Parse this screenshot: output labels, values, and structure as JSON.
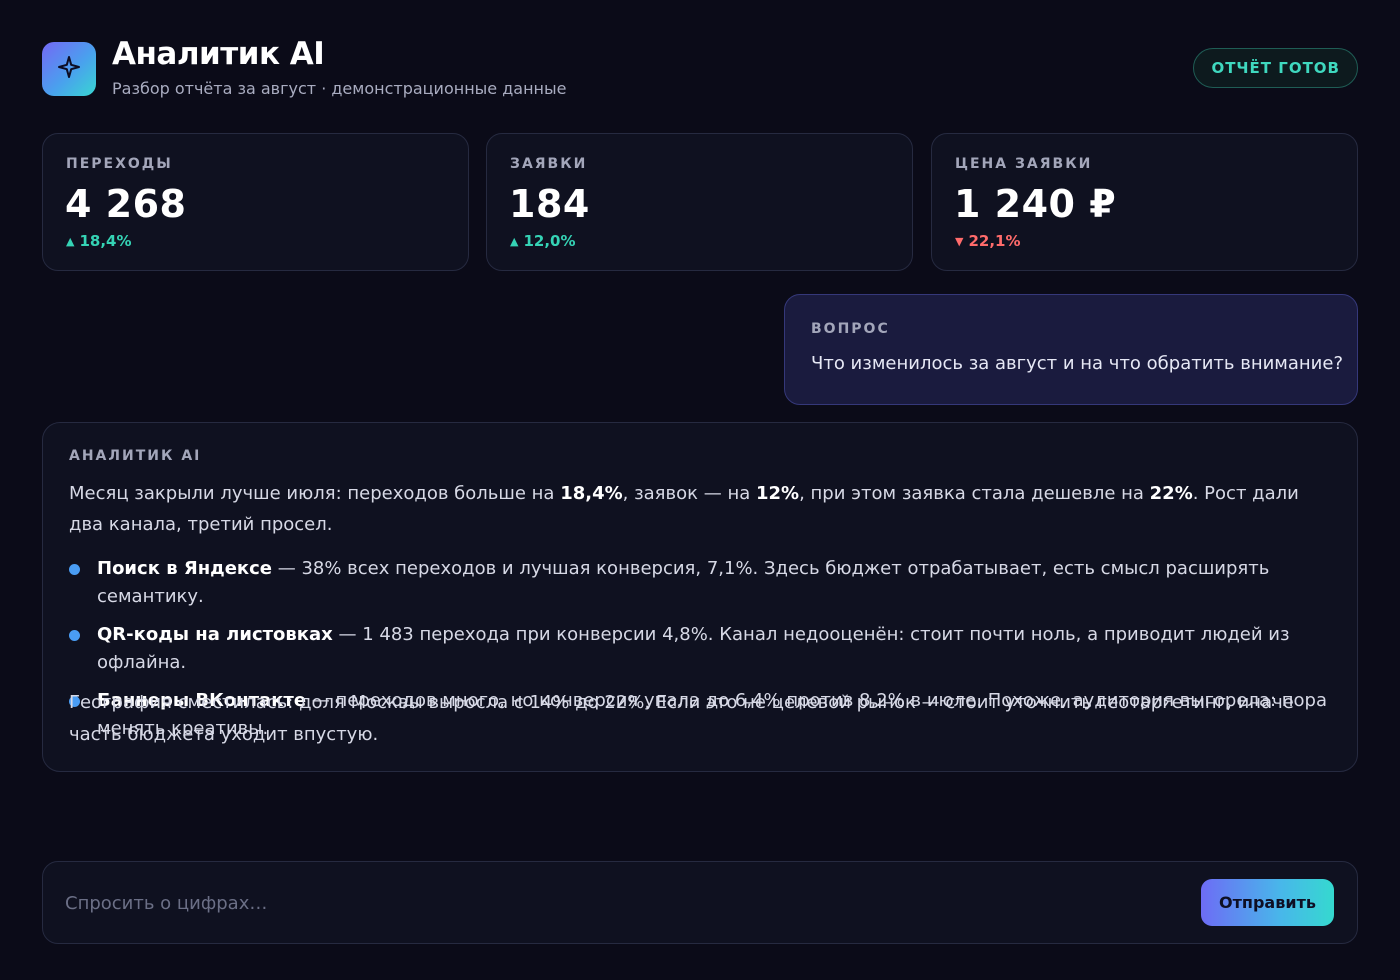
{
  "header": {
    "title": "Аналитик AI",
    "subtitle": "Разбор отчёта за август · демонстрационные данные",
    "status": "ОТЧЁТ ГОТОВ",
    "logo_icon": "sparkle-icon"
  },
  "metrics": [
    {
      "label": "ПЕРЕХОДЫ",
      "value": "4 268",
      "change": "18,4%",
      "direction": "up"
    },
    {
      "label": "ЗАЯВКИ",
      "value": "184",
      "change": "12,0%",
      "direction": "up"
    },
    {
      "label": "ЦЕНА ЗАЯВКИ",
      "value": "1 240 ₽",
      "change": "22,1%",
      "direction": "down"
    }
  ],
  "arrows": {
    "up": "▲",
    "down": "▼"
  },
  "question": {
    "label": "ВОПРОС",
    "text": "Что изменилось за август и на что обратить внимание?"
  },
  "answer": {
    "label": "АНАЛИТИК AI",
    "intro": [
      {
        "t": "Месяц закрыли лучше июля: переходов больше на "
      },
      {
        "t": "18,4%",
        "b": true
      },
      {
        "t": ", заявок — на "
      },
      {
        "t": "12%",
        "b": true
      },
      {
        "t": ", при этом заявка стала дешевле на "
      },
      {
        "t": "22%",
        "b": true
      },
      {
        "t": ". Рост дали два канала, третий просел."
      }
    ],
    "bullets": [
      {
        "bold": "Поиск в Яндексе",
        "text": " — 38% всех переходов и лучшая конверсия, 7,1%. Здесь бюджет отрабатывает, есть смысл расширять семантику."
      },
      {
        "bold": "QR-коды на листовках",
        "text": " — 1 483 перехода при конверсии 4,8%. Канал недооценён: стоит почти ноль, а приводит людей из офлайна."
      },
      {
        "bold": "Баннеры ВКонтакте",
        "text": " — переходов много, но конверсия упала до 6,4% против 8,2% в июле. Похоже, аудитория выгорела: пора менять креативы."
      }
    ],
    "outro": "География сместилась: доля Москвы выросла с 14% до 22%. Если это не целевой рынок — стоит уточнить геотаргетинг, иначе часть бюджета уходит впустую."
  },
  "composer": {
    "placeholder": "Спросить о цифрах…",
    "value": "",
    "send_label": "Отправить"
  },
  "colors": {
    "background": "#0b0b18",
    "accent_up": "#35d3b5",
    "accent_down": "#ff6b6b",
    "bullet": "#4a9df4"
  }
}
